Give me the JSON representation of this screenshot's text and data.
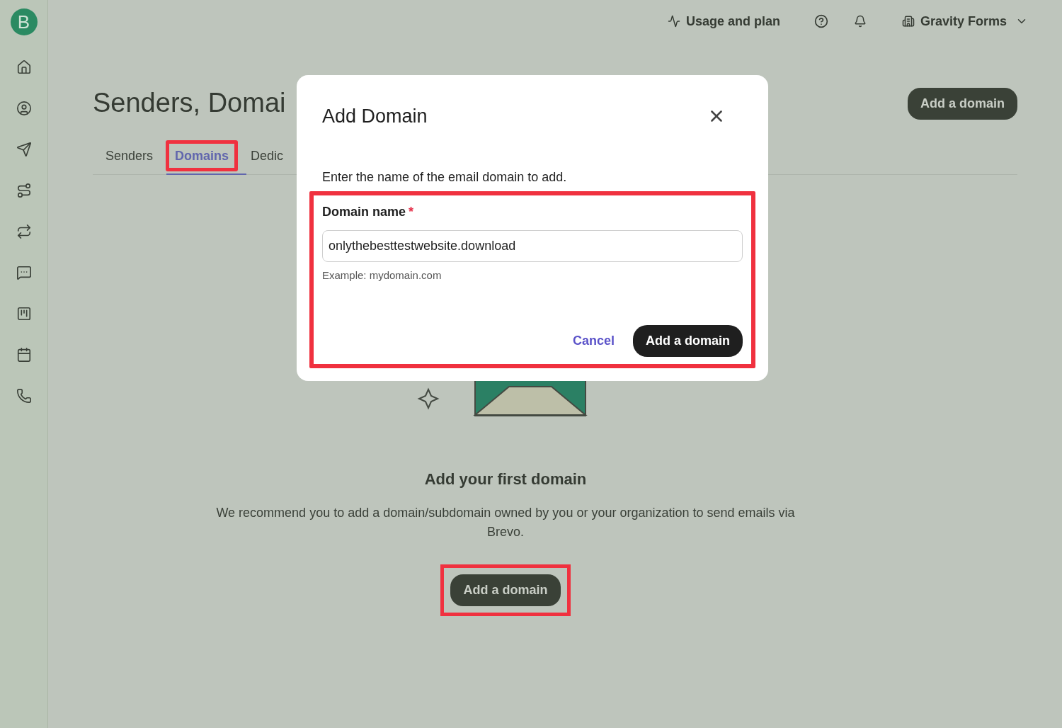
{
  "sidebar": {
    "logo": "B"
  },
  "topbar": {
    "usage": "Usage and plan",
    "account": "Gravity Forms"
  },
  "page": {
    "title": "Senders, Domai",
    "action": "Add a domain"
  },
  "tabs": [
    {
      "label": "Senders",
      "selected": false,
      "highlighted": false
    },
    {
      "label": "Domains",
      "selected": true,
      "highlighted": true
    },
    {
      "label": "Dedic",
      "selected": false,
      "highlighted": false
    }
  ],
  "empty_state": {
    "heading": "Add your first domain",
    "text": "We recommend you to add a domain/subdomain owned by you or your organization to send emails via Brevo.",
    "button": "Add a domain",
    "highlighted": true
  },
  "dialog": {
    "title": "Add Domain",
    "intro": "Enter the name of the email domain to add.",
    "highlighted": true,
    "field": {
      "label": "Domain name",
      "required_mark": "*",
      "value": "onlythebesttestwebsite.download",
      "hint": "Example: mydomain.com"
    },
    "cancel": "Cancel",
    "submit": "Add a domain"
  }
}
